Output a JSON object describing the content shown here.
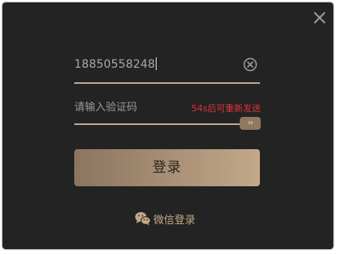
{
  "phone": {
    "value": "18850558248"
  },
  "code": {
    "placeholder": "请输入验证码",
    "countdown": "54s后可重新发送"
  },
  "slider": {
    "handle_label": "››"
  },
  "login_button": {
    "label": "登录"
  },
  "wechat": {
    "label": "微信登录"
  },
  "colors": {
    "background": "#232323",
    "accent": "#c3a888",
    "countdown": "#e0313a"
  },
  "icons": {
    "close": "close-icon",
    "clear": "clear-circle-icon",
    "wechat": "wechat-icon"
  }
}
